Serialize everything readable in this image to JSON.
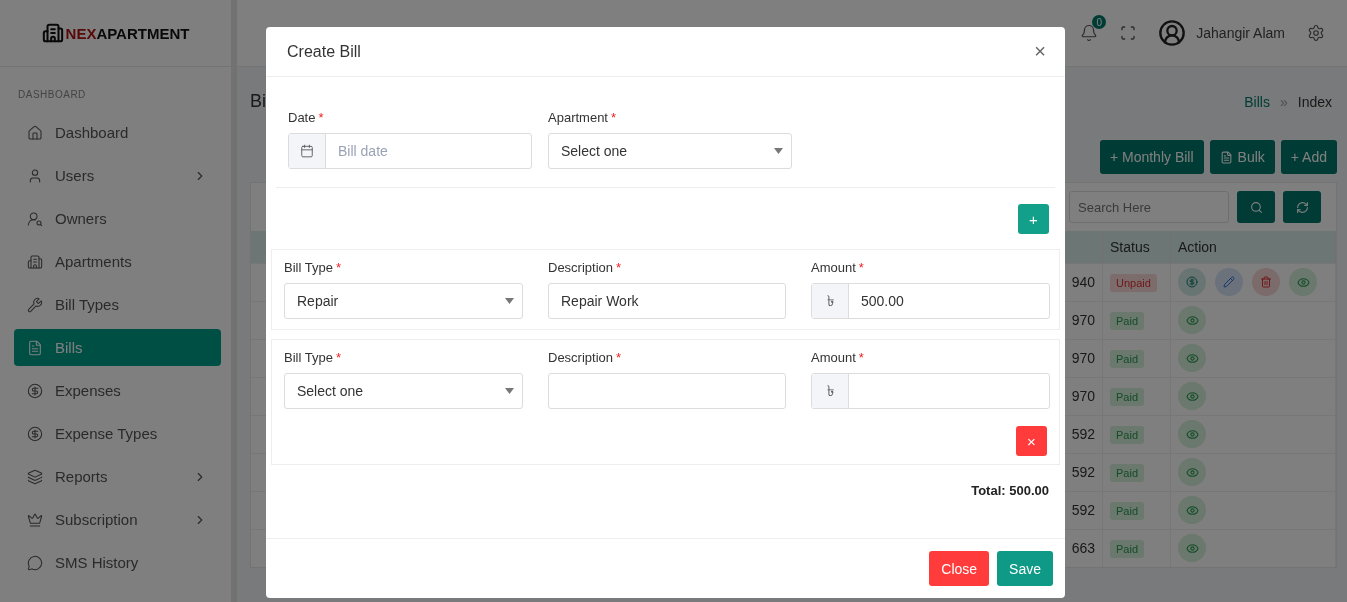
{
  "brand": {
    "accent": "NEX",
    "rest": "APARTMENT"
  },
  "sidebar": {
    "section": "DASHBOARD",
    "items": [
      {
        "label": "Dashboard",
        "selected": false,
        "expandable": false
      },
      {
        "label": "Users",
        "selected": false,
        "expandable": true
      },
      {
        "label": "Owners",
        "selected": false,
        "expandable": false
      },
      {
        "label": "Apartments",
        "selected": false,
        "expandable": false
      },
      {
        "label": "Bill Types",
        "selected": false,
        "expandable": false
      },
      {
        "label": "Bills",
        "selected": true,
        "expandable": false
      },
      {
        "label": "Expenses",
        "selected": false,
        "expandable": false
      },
      {
        "label": "Expense Types",
        "selected": false,
        "expandable": false
      },
      {
        "label": "Reports",
        "selected": false,
        "expandable": true
      },
      {
        "label": "Subscription",
        "selected": false,
        "expandable": true
      },
      {
        "label": "SMS History",
        "selected": false,
        "expandable": false
      }
    ]
  },
  "header": {
    "notification_count": "0",
    "user_name": "Jahangir Alam"
  },
  "page": {
    "title": "Bi",
    "breadcrumb": {
      "parent": "Bills",
      "separator": "»",
      "current": "Index"
    }
  },
  "toolbar": [
    "+ Monthly Bill",
    "Bulk",
    "+ Add"
  ],
  "search": {
    "placeholder": "Search Here"
  },
  "table": {
    "columns": [
      "Status",
      "Action"
    ],
    "rows": [
      {
        "column_1": "940",
        "status": "Unpaid",
        "paid": false
      },
      {
        "column_1": "970",
        "status": "Paid",
        "paid": true
      },
      {
        "column_1": "970",
        "status": "Paid",
        "paid": true
      },
      {
        "column_1": "970",
        "status": "Paid",
        "paid": true
      },
      {
        "column_1": "592",
        "status": "Paid",
        "paid": true
      },
      {
        "column_1": "592",
        "status": "Paid",
        "paid": true
      },
      {
        "column_1": "592",
        "status": "Paid",
        "paid": true
      },
      {
        "column_1": "663",
        "status": "Paid",
        "paid": true
      }
    ]
  },
  "modal": {
    "title": "Create Bill",
    "close_icon": "×",
    "top_fields": [
      {
        "kind": "date",
        "label": "Date",
        "mark": "*",
        "placeholder": "Bill date"
      },
      {
        "kind": "select",
        "label": "Apartment",
        "mark": "*",
        "value": "Select one"
      }
    ],
    "add_button": "+",
    "items": [
      {
        "fields": [
          {
            "kind": "select",
            "label": "Bill Type",
            "mark": "*",
            "value": "Repair"
          },
          {
            "kind": "text",
            "label": "Description",
            "mark": "*",
            "value": "Repair Work"
          },
          {
            "kind": "currency",
            "label": "Amount",
            "mark": "*",
            "prefix": "৳",
            "value": "500.00"
          }
        ]
      },
      {
        "fields": [
          {
            "kind": "select",
            "label": "Bill Type",
            "mark": "*",
            "value": "Select one"
          },
          {
            "kind": "text",
            "label": "Description",
            "mark": "*"
          },
          {
            "kind": "currency",
            "label": "Amount",
            "mark": "*",
            "prefix": "৳"
          }
        ],
        "remove": "×"
      }
    ],
    "total": "Total: 500.00",
    "buttons": [
      {
        "label": "Close",
        "kind": "danger"
      },
      {
        "label": "Save",
        "kind": "primary"
      }
    ]
  }
}
